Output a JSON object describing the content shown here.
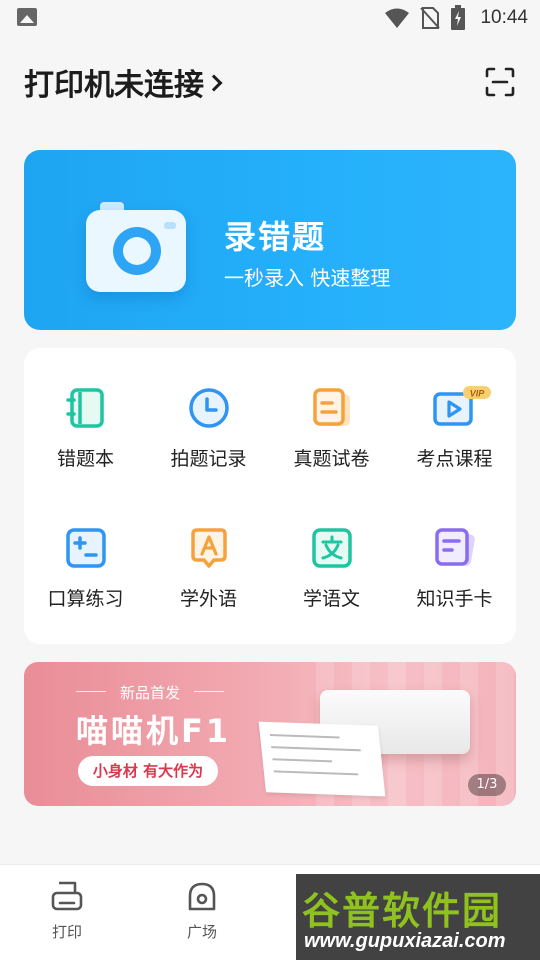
{
  "status_bar": {
    "time": "10:44"
  },
  "header": {
    "title": "打印机未连接"
  },
  "hero": {
    "title": "录错题",
    "subtitle": "一秒录入 快速整理"
  },
  "grid": {
    "items": [
      {
        "label": "错题本",
        "icon": "notebook-icon",
        "color": "#1fc4a0"
      },
      {
        "label": "拍题记录",
        "icon": "clock-icon",
        "color": "#2f95f2"
      },
      {
        "label": "真题试卷",
        "icon": "papers-icon",
        "color": "#f5a23c"
      },
      {
        "label": "考点课程",
        "icon": "video-vip-icon",
        "color": "#2f95f2",
        "badge": "VIP"
      },
      {
        "label": "口算练习",
        "icon": "calculator-icon",
        "color": "#2f95f2"
      },
      {
        "label": "学外语",
        "icon": "language-a-icon",
        "color": "#f5a23c"
      },
      {
        "label": "学语文",
        "icon": "chinese-wen-icon",
        "color": "#1fc4a0"
      },
      {
        "label": "知识手卡",
        "icon": "cards-icon",
        "color": "#8a6cf0"
      }
    ]
  },
  "banner": {
    "tag": "新品首发",
    "title": "喵喵机F1",
    "pill": "小身材 有大作为",
    "page_indicator": "1/3"
  },
  "bottom_nav": {
    "items": [
      {
        "label": "打印",
        "icon": "printer-icon"
      },
      {
        "label": "广场",
        "icon": "square-icon"
      }
    ]
  },
  "watermark": {
    "title": "谷普软件园",
    "url": "www.gupuxiazai.com"
  }
}
